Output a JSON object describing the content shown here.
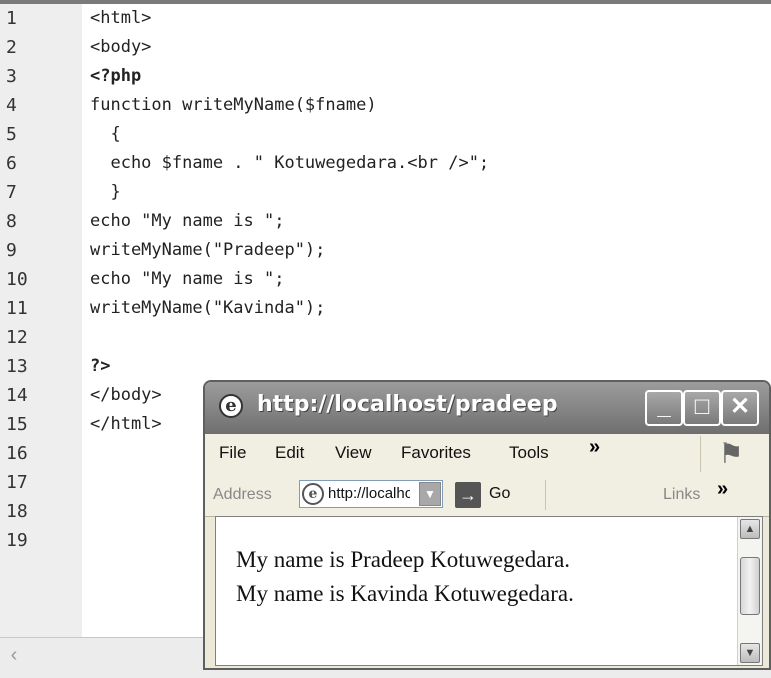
{
  "editor": {
    "line_numbers": [
      "1",
      "2",
      "3",
      "4",
      "5",
      "6",
      "7",
      "8",
      "9",
      "10",
      "11",
      "12",
      "13",
      "14",
      "15",
      "16",
      "17",
      "18",
      "19"
    ],
    "code_lines": [
      "<html>",
      "<body>",
      "<?php",
      "function writeMyName($fname)",
      "  {",
      "  echo $fname . \" Kotuwegedara.<br />\";",
      "  }",
      "echo \"My name is \";",
      "writeMyName(\"Pradeep\");",
      "echo \"My name is \";",
      "writeMyName(\"Kavinda\");",
      "",
      "?>",
      "</body>",
      "</html>"
    ]
  },
  "browser": {
    "title": "http://localhost/pradeep/...",
    "menu": [
      "File",
      "Edit",
      "View",
      "Favorites",
      "Tools"
    ],
    "address_label": "Address",
    "address_value": "http://localhos",
    "go_label": "Go",
    "links_label": "Links",
    "chevron": "»",
    "output": [
      "My name is Pradeep Kotuwegedara.",
      "My name is Kavinda Kotuwegedara."
    ]
  },
  "icons": {
    "ie_icon": "e",
    "minimize": "_",
    "maximize": "□",
    "close": "✕",
    "go": "→",
    "dropdown": "▼",
    "up": "▲",
    "down": "▼",
    "hscroll_left": "‹",
    "xp_logo": "⚑"
  }
}
